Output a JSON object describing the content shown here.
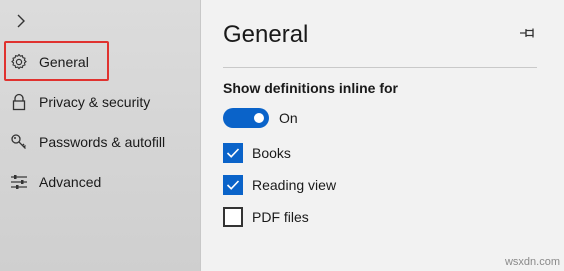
{
  "sidebar": {
    "items": [
      {
        "label": "General",
        "icon": "gear-icon"
      },
      {
        "label": "Privacy & security",
        "icon": "lock-icon"
      },
      {
        "label": "Passwords & autofill",
        "icon": "key-icon"
      },
      {
        "label": "Advanced",
        "icon": "sliders-icon"
      }
    ],
    "selected_highlight_color": "#e0322f"
  },
  "panel": {
    "title": "General",
    "section_heading": "Show definitions inline for",
    "toggle": {
      "label": "On",
      "state": true,
      "color": "#0a63c9"
    },
    "checkboxes": [
      {
        "label": "Books",
        "checked": true
      },
      {
        "label": "Reading view",
        "checked": true
      },
      {
        "label": "PDF files",
        "checked": false
      }
    ]
  },
  "watermark": "wsxdn.com"
}
